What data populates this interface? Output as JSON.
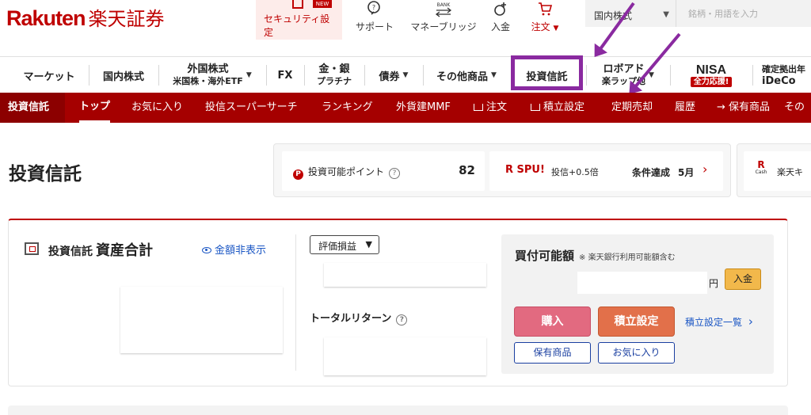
{
  "header": {
    "logo_en": "Rakuten",
    "logo_jp": "楽天証券",
    "security": {
      "badge": "NEW",
      "label": "セキュリティ設定"
    },
    "items": [
      {
        "label": "サポート",
        "icon": "support-icon"
      },
      {
        "label": "マネーブリッジ",
        "icon": "bank-icon",
        "icon_text": "BANK"
      },
      {
        "label": "入金",
        "icon": "deposit-icon"
      },
      {
        "label": "注文",
        "icon": "cart-icon"
      }
    ],
    "search": {
      "market": "国内株式",
      "placeholder": "銘柄・用語を入力"
    }
  },
  "main_nav": {
    "items": [
      {
        "label": "マーケット"
      },
      {
        "label": "国内株式"
      },
      {
        "label": "外国株式",
        "sub": "米国株・海外ETF"
      },
      {
        "label": "FX"
      },
      {
        "label": "金・銀",
        "sub": "プラチナ"
      },
      {
        "label": "債券"
      },
      {
        "label": "その他商品"
      },
      {
        "label": "投資信託"
      },
      {
        "label": "ロボアド",
        "sub": "楽ラップ他"
      },
      {
        "label": "NISA",
        "badge": "全力応援!"
      },
      {
        "label": "確定拠出年",
        "sub": "iDeCo"
      }
    ]
  },
  "sub_nav": {
    "section": "投資信託",
    "items": [
      "トップ",
      "お気に入り",
      "投信スーパーサーチ",
      "ランキング",
      "外貨建MMF",
      "注文",
      "積立設定",
      "定期売却",
      "履歴",
      "→ 保有商品",
      "その"
    ]
  },
  "page": {
    "title": "投資信託",
    "points_label": "投資可能ポイント",
    "points_value": "82",
    "spu_label": "R SPU!",
    "spu_desc": "投信+0.5倍",
    "spu_status": "条件達成",
    "spu_month": "5月",
    "cash_icon_text": "Cash",
    "cash_label": "楽天キ"
  },
  "assets": {
    "title": "投資信託",
    "title_big": "資産合計",
    "hide_link": "金額非表示",
    "eval_select": "評価損益",
    "total_return": "トータルリターン"
  },
  "buy_panel": {
    "title": "買付可能額",
    "note": "※ 楽天銀行利用可能額含む",
    "yen": "円",
    "deposit": "入金",
    "buy": "購入",
    "tsumitate": "積立設定",
    "list_link": "積立設定一覧",
    "holdings": "保有商品",
    "favorites": "お気に入り"
  },
  "colors": {
    "brand": "#bf0000",
    "subnav": "#a50000",
    "annotation": "#8a2aa0",
    "link": "#1a56c4"
  }
}
